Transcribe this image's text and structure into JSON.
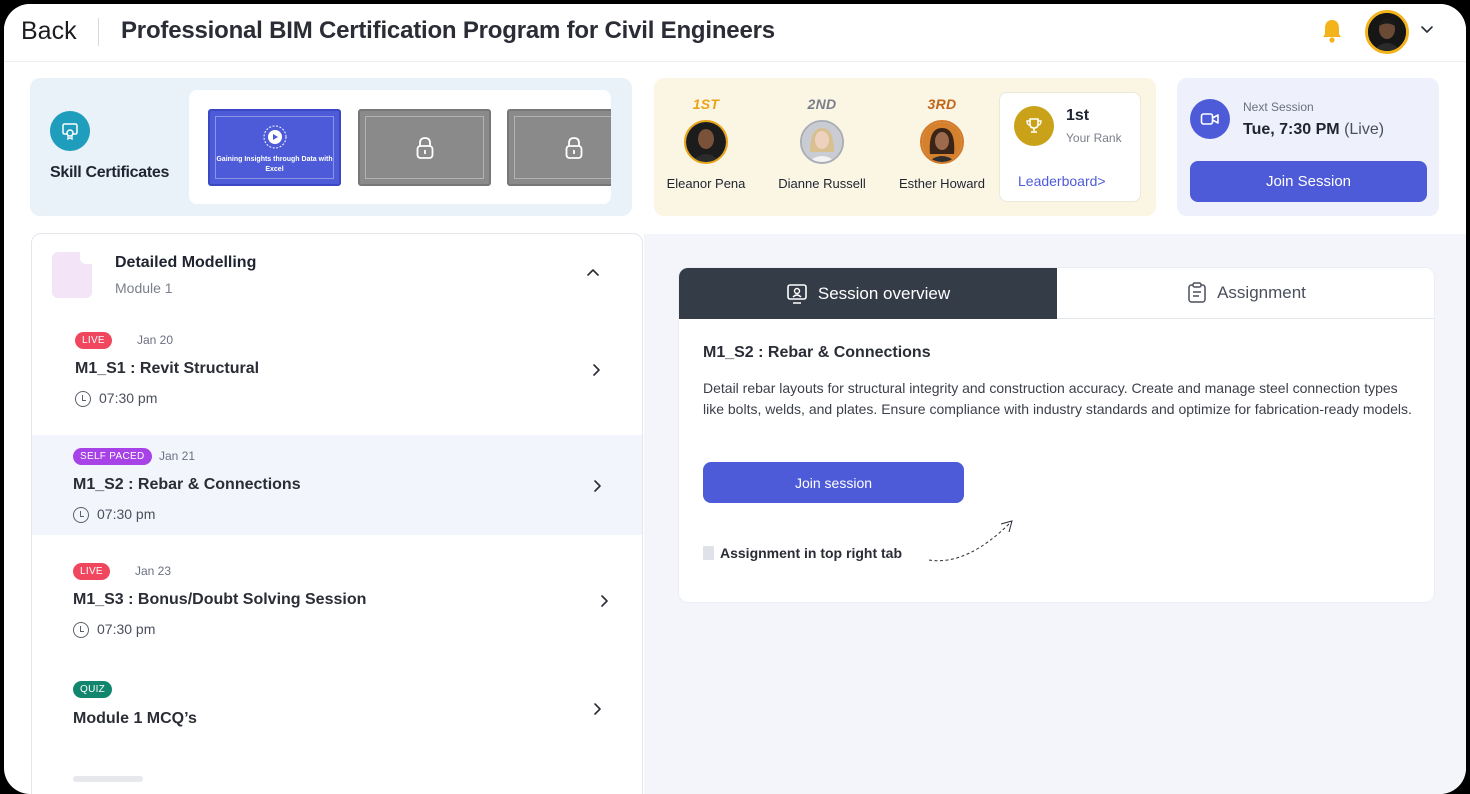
{
  "header": {
    "back_label": "Back",
    "title": "Professional BIM Certification Program for Civil Engineers",
    "bell_icon": "bell-icon",
    "accent": "#f3b31a"
  },
  "certificates": {
    "label": "Skill Certificates",
    "cards": [
      {
        "state": "unlocked",
        "text": "Gaining Insights through Data with Excel"
      },
      {
        "state": "locked",
        "icon": "lock-icon"
      },
      {
        "state": "locked",
        "icon": "lock-icon"
      }
    ]
  },
  "leaderboard": {
    "ranks": [
      {
        "position": "1ST",
        "name": "Eleanor Pena",
        "color": "#e8a316"
      },
      {
        "position": "2ND",
        "name": "Dianne Russell",
        "color": "#7a7f8a"
      },
      {
        "position": "3RD",
        "name": "Esther Howard",
        "color": "#c0651a"
      }
    ],
    "my_rank_value": "1st",
    "my_rank_label": "Your Rank",
    "link_label": "Leaderboard>"
  },
  "next_session": {
    "label": "Next Session",
    "time": "Tue, 7:30 PM",
    "status": "(Live)",
    "join_label": "Join Session"
  },
  "module": {
    "title": "Detailed Modelling",
    "subtitle": "Module 1",
    "items": [
      {
        "badge": "LIVE",
        "type": "live",
        "date": "Jan 20",
        "title": "M1_S1 : Revit Structural",
        "time": "07:30 pm"
      },
      {
        "badge": "SELF PACED",
        "type": "self",
        "date": "Jan 21",
        "title": "M1_S2 : Rebar & Connections",
        "time": "07:30 pm"
      },
      {
        "badge": "LIVE",
        "type": "live",
        "date": "Jan 23",
        "title": "M1_S3 : Bonus/Doubt Solving Session",
        "time": "07:30 pm"
      },
      {
        "badge": "QUIZ",
        "type": "quiz",
        "title": "Module 1 MCQ’s"
      }
    ]
  },
  "detail": {
    "tabs": [
      {
        "label": "Session overview",
        "icon": "presentation-icon"
      },
      {
        "label": "Assignment",
        "icon": "clipboard-icon"
      }
    ],
    "title": "M1_S2 :  Rebar & Connections",
    "description": "Detail rebar layouts for structural integrity and construction accuracy. Create and manage steel connection types like bolts, welds, and plates. Ensure compliance with industry standards and optimize for fabrication-ready models.",
    "join_label": "Join session",
    "note": "Assignment in top right tab"
  },
  "colors": {
    "primary": "#4d5bd9",
    "dark_tab": "#333c47",
    "live": "#f0475e",
    "self_paced": "#a642e6",
    "quiz": "#12856f"
  }
}
